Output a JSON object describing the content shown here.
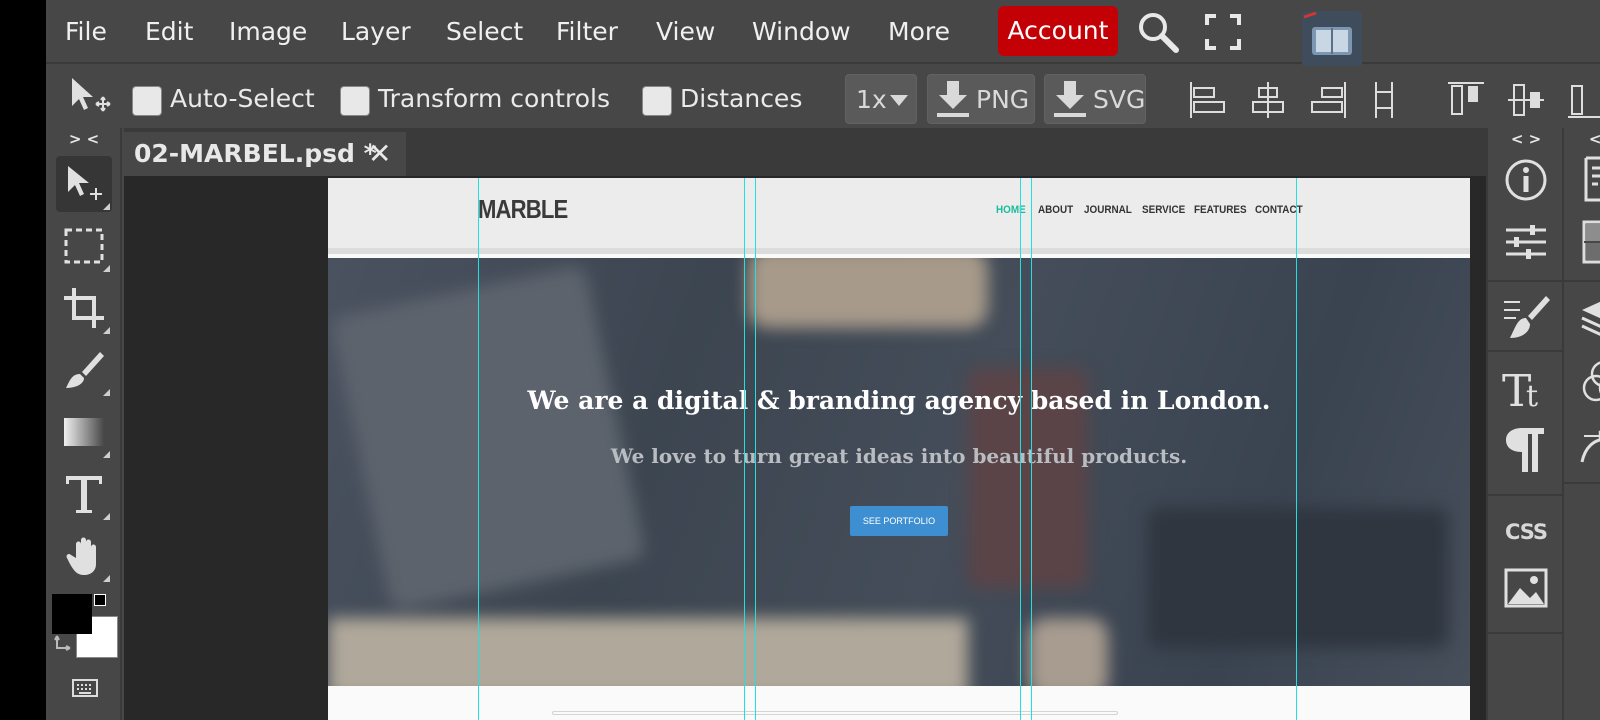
{
  "menubar": {
    "items": [
      "File",
      "Edit",
      "Image",
      "Layer",
      "Select",
      "Filter",
      "View",
      "Window",
      "More"
    ],
    "account_label": "Account",
    "account_color": "#c40007"
  },
  "options": {
    "auto_select_label": "Auto-Select",
    "transform_controls_label": "Transform controls",
    "distances_label": "Distances",
    "zoom_value": "1x",
    "png_label": "PNG",
    "svg_label": "SVG"
  },
  "panels": {
    "left_collapse": "> <",
    "right_collapse_1": "< >",
    "right_collapse_2": "< >",
    "css_label": "CSS"
  },
  "document": {
    "tab_title": "02-MARBEL.psd *",
    "close_glyph": "✕"
  },
  "website": {
    "logo": "MARBLE",
    "nav": [
      "HOME",
      "ABOUT",
      "JOURNAL",
      "SERVICE",
      "FEATURES",
      "CONTACT"
    ],
    "nav_active_color": "#1bbc9b",
    "hero_title": "We are a digital & branding agency based in London.",
    "hero_subtitle": "We love to turn great ideas into beautiful products.",
    "cta_label": "SEE PORTFOLIO",
    "cta_color": "#3d8fd1"
  },
  "colors": {
    "foreground": "#000000",
    "background": "#ffffff",
    "guide": "#21e0e0"
  }
}
